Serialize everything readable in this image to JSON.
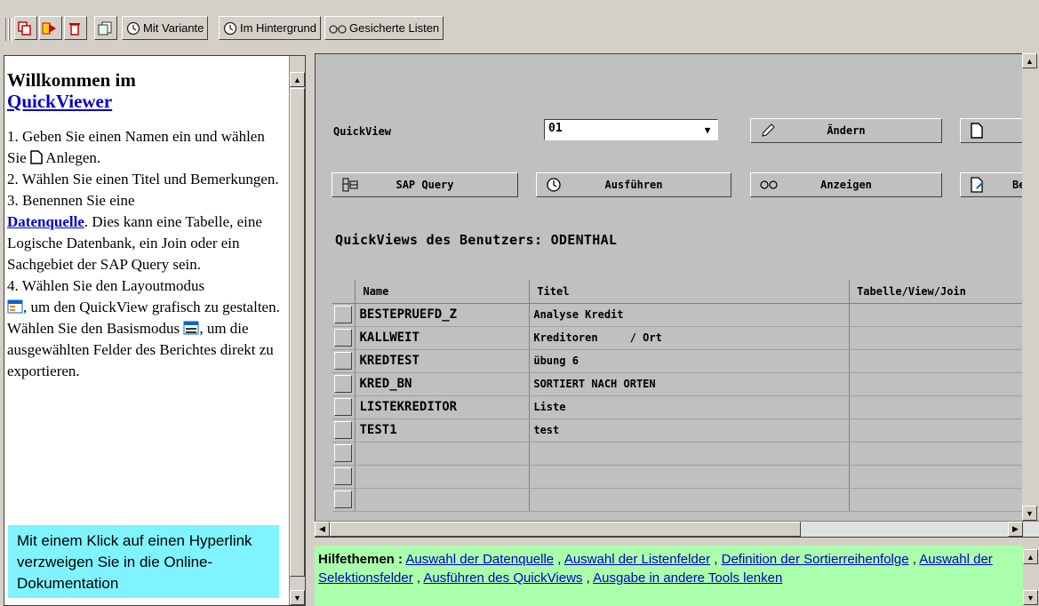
{
  "toolbar": {
    "btn_variant": "Mit Variante",
    "btn_background": "Im Hintergrund",
    "btn_saved_lists": "Gesicherte Listen"
  },
  "welcome": {
    "heading": "Willkommen im",
    "link": "QuickViewer",
    "step1a": "1. Geben Sie einen Namen ein und wählen Sie",
    "step1b": "Anlegen.",
    "step2": "2. Wählen Sie einen Titel und Bemerkungen.",
    "step3a": "3. Benennen Sie eine",
    "step3_link": "Datenquelle",
    "step3b": ". Dies kann eine Tabelle, eine Logische Datenbank, ein Join oder ein Sachgebiet der SAP Query sein.",
    "step4a": "4. Wählen Sie den Layoutmodus",
    "step4b": ", um den QuickView grafisch zu gestalten. Wählen Sie den Basismodus",
    "step4c": ", um die ausgewählten Felder des Berichtes direkt zu exportieren.",
    "hint": "Mit einem Klick auf einen Hyperlink verzweigen Sie in die Online-Dokumentation"
  },
  "form": {
    "quickview_label": "QuickView",
    "quickview_value": "01",
    "btn_change": "Ändern",
    "btn_sap_query": "SAP Query",
    "btn_execute": "Ausführen",
    "btn_display": "Anzeigen",
    "btn_be": "Be",
    "list_title": "QuickViews des Benutzers: ODENTHAL"
  },
  "table": {
    "headers": [
      "Name",
      "Titel",
      "Tabelle/View/Join"
    ],
    "rows": [
      {
        "name": "BESTEPRUEFD_Z",
        "title": "Analyse Kredit",
        "view": ""
      },
      {
        "name": "KALLWEIT",
        "title": "Kreditoren     / Ort",
        "view": ""
      },
      {
        "name": "KREDTEST",
        "title": "übung 6",
        "view": ""
      },
      {
        "name": "KRED_BN",
        "title": "SORTIERT NACH ORTEN",
        "view": ""
      },
      {
        "name": "LISTEKREDITOR",
        "title": "Liste",
        "view": ""
      },
      {
        "name": "TEST1",
        "title": "test",
        "view": ""
      }
    ]
  },
  "help": {
    "label": "Hilfethemen :",
    "links": [
      "Auswahl der Datenquelle",
      "Auswahl der Listenfelder",
      "Definition der Sortierreihenfolge",
      "Auswahl der Selektionsfelder",
      "Ausführen des QuickViews",
      "Ausgabe in andere Tools lenken"
    ]
  }
}
